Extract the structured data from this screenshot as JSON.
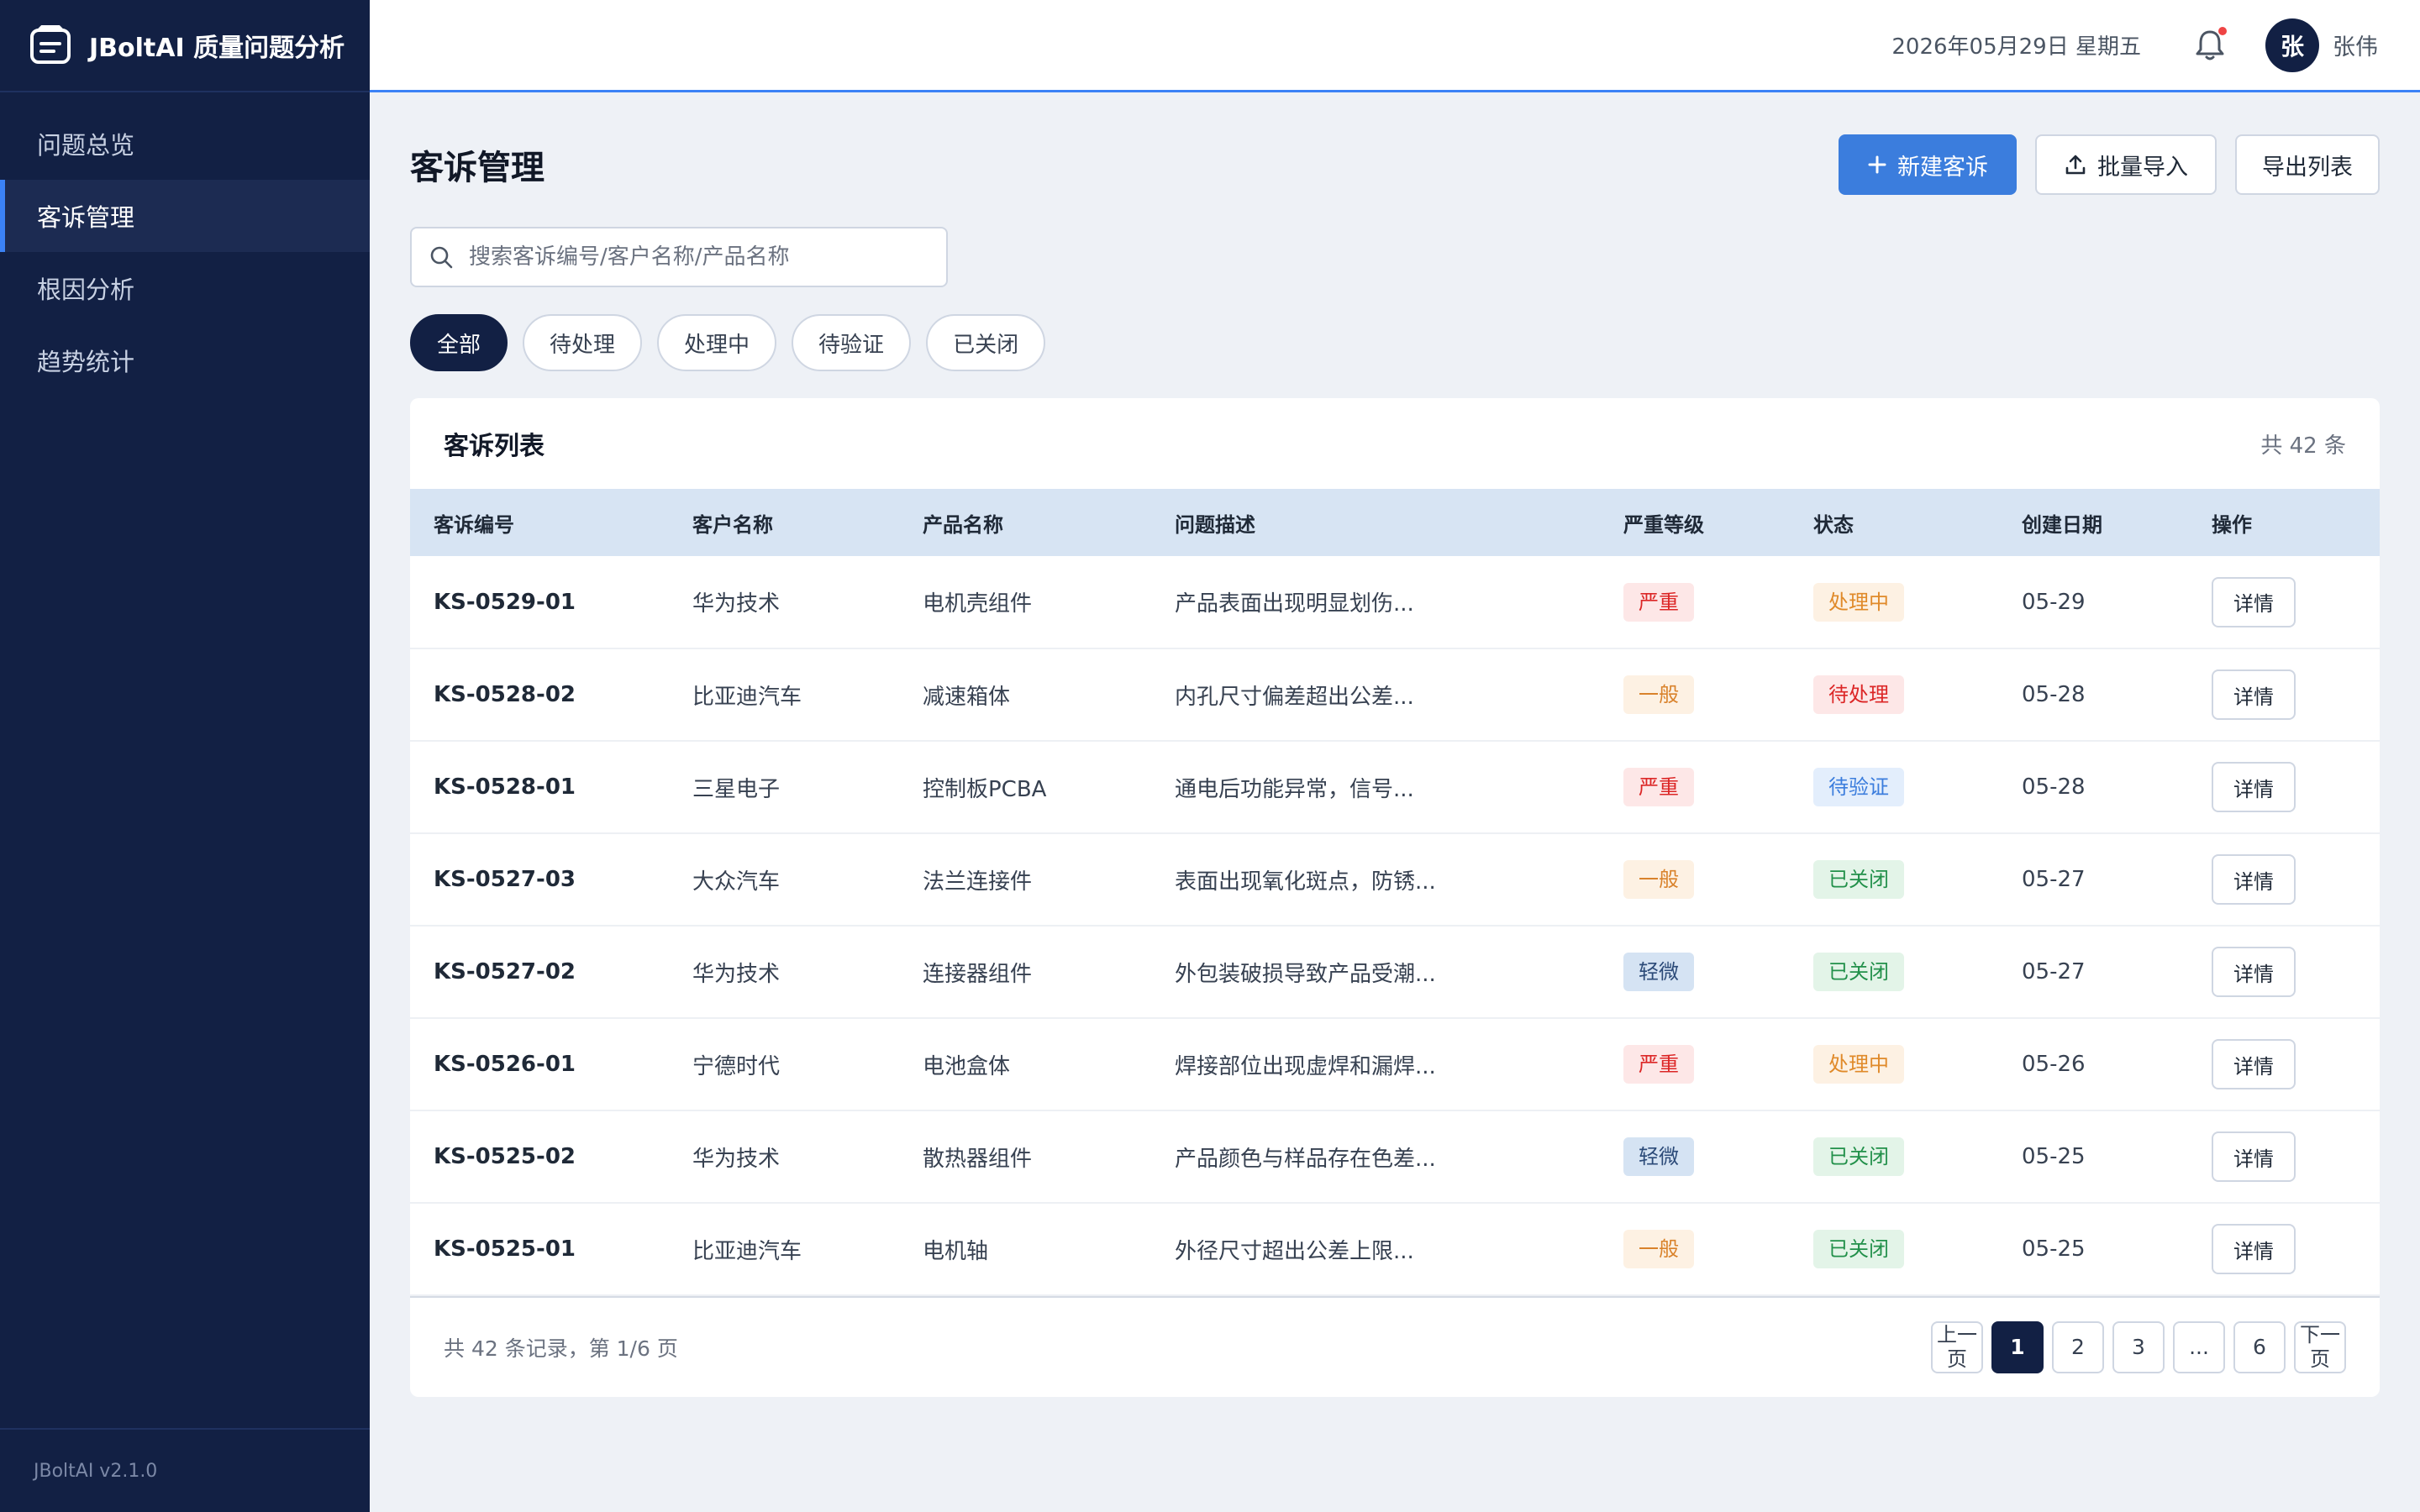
{
  "app": {
    "title": "JBoltAI 质量问题分析",
    "version": "JBoltAI v2.1.0"
  },
  "sidebar": {
    "items": [
      {
        "label": "问题总览"
      },
      {
        "label": "客诉管理"
      },
      {
        "label": "根因分析"
      },
      {
        "label": "趋势统计"
      }
    ],
    "active_index": 1
  },
  "header": {
    "date": "2026年05月29日 星期五",
    "avatar_initial": "张",
    "username": "张伟",
    "notification_dot": true
  },
  "page": {
    "title": "客诉管理"
  },
  "toolbar": {
    "new_label": "新建客诉",
    "import_label": "批量导入",
    "export_label": "导出列表"
  },
  "search": {
    "placeholder": "搜索客诉编号/客户名称/产品名称",
    "value": ""
  },
  "filters": [
    {
      "label": "全部",
      "active": true
    },
    {
      "label": "待处理",
      "active": false
    },
    {
      "label": "处理中",
      "active": false
    },
    {
      "label": "待验证",
      "active": false
    },
    {
      "label": "已关闭",
      "active": false
    }
  ],
  "list": {
    "title": "客诉列表",
    "count_label": "共 42 条",
    "columns": [
      "客诉编号",
      "客户名称",
      "产品名称",
      "问题描述",
      "严重等级",
      "状态",
      "创建日期",
      "操作"
    ],
    "rows": [
      {
        "code": "KS-0529-01",
        "customer": "华为技术",
        "product": "电机壳组件",
        "desc": "产品表面出现明显划伤...",
        "severity": "严重",
        "severity_type": "serious",
        "status": "处理中",
        "status_type": "processing",
        "date": "05-29",
        "action": "详情"
      },
      {
        "code": "KS-0528-02",
        "customer": "比亚迪汽车",
        "product": "减速箱体",
        "desc": "内孔尺寸偏差超出公差...",
        "severity": "一般",
        "severity_type": "normal",
        "status": "待处理",
        "status_type": "pending",
        "date": "05-28",
        "action": "详情"
      },
      {
        "code": "KS-0528-01",
        "customer": "三星电子",
        "product": "控制板PCBA",
        "desc": "通电后功能异常，信号...",
        "severity": "严重",
        "severity_type": "serious",
        "status": "待验证",
        "status_type": "verify",
        "date": "05-28",
        "action": "详情"
      },
      {
        "code": "KS-0527-03",
        "customer": "大众汽车",
        "product": "法兰连接件",
        "desc": "表面出现氧化斑点，防锈...",
        "severity": "一般",
        "severity_type": "normal",
        "status": "已关闭",
        "status_type": "closed",
        "date": "05-27",
        "action": "详情"
      },
      {
        "code": "KS-0527-02",
        "customer": "华为技术",
        "product": "连接器组件",
        "desc": "外包装破损导致产品受潮...",
        "severity": "轻微",
        "severity_type": "minor",
        "status": "已关闭",
        "status_type": "closed",
        "date": "05-27",
        "action": "详情"
      },
      {
        "code": "KS-0526-01",
        "customer": "宁德时代",
        "product": "电池盒体",
        "desc": "焊接部位出现虚焊和漏焊...",
        "severity": "严重",
        "severity_type": "serious",
        "status": "处理中",
        "status_type": "processing",
        "date": "05-26",
        "action": "详情"
      },
      {
        "code": "KS-0525-02",
        "customer": "华为技术",
        "product": "散热器组件",
        "desc": "产品颜色与样品存在色差...",
        "severity": "轻微",
        "severity_type": "minor",
        "status": "已关闭",
        "status_type": "closed",
        "date": "05-25",
        "action": "详情"
      },
      {
        "code": "KS-0525-01",
        "customer": "比亚迪汽车",
        "product": "电机轴",
        "desc": "外径尺寸超出公差上限...",
        "severity": "一般",
        "severity_type": "normal",
        "status": "已关闭",
        "status_type": "closed",
        "date": "05-25",
        "action": "详情"
      }
    ]
  },
  "pagination": {
    "info": "共 42 条记录，第 1/6 页",
    "prev_label": "上一页",
    "next_label": "下一页",
    "pages": [
      "1",
      "2",
      "3",
      "...",
      "6"
    ],
    "current": "1"
  },
  "colors": {
    "sidebar_bg": "#122044",
    "accent": "#3b7ddd",
    "table_header_bg": "#d7e4f3"
  },
  "icons": {
    "brand": "document-icon",
    "bell": "bell-icon",
    "search": "search-icon",
    "plus": "plus-icon",
    "upload": "upload-icon"
  }
}
